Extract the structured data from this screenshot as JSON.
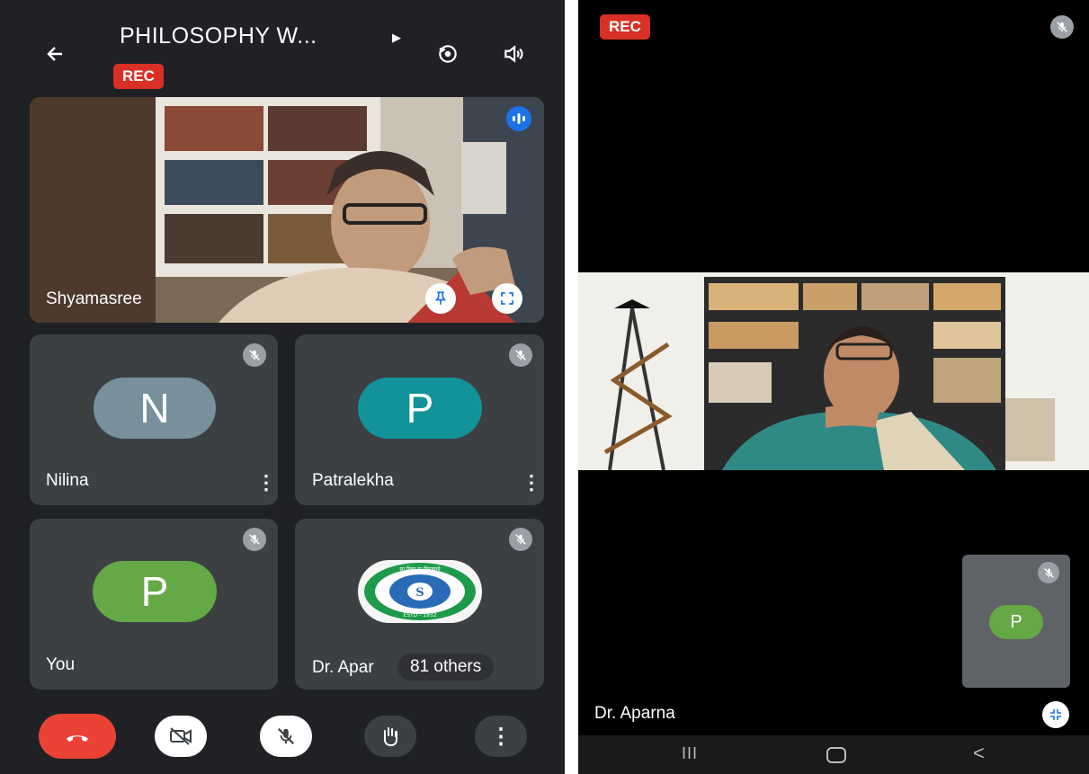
{
  "left_screen": {
    "meeting_title": "PHILOSOPHY W...",
    "rec_label": "REC",
    "tiles": [
      {
        "name": "Shyamasree"
      },
      {
        "name": "Nilina",
        "initial": "N",
        "avatar_color": "#78909c"
      },
      {
        "name": "Patralekha",
        "initial": "P",
        "avatar_color": "#12939a"
      },
      {
        "name": "You",
        "initial": "P",
        "avatar_color": "#65a846"
      },
      {
        "name": "Dr. Apar",
        "others_label": "81 others"
      }
    ],
    "logo_text": {
      "top": "सा विद्या या विमुक्तये",
      "bottom": "ESTD - 1932",
      "center": "S"
    },
    "controls": [
      "end-call",
      "camera-off",
      "mic-off",
      "raise-hand",
      "more"
    ]
  },
  "right_screen": {
    "rec_label": "REC",
    "main_speaker": "Dr. Aparna",
    "self_initial": "P",
    "self_avatar_color": "#65a846"
  },
  "colors": {
    "rec": "#d93025",
    "end_call": "#ea4335",
    "tile": "#3c4043",
    "background": "#202124"
  }
}
